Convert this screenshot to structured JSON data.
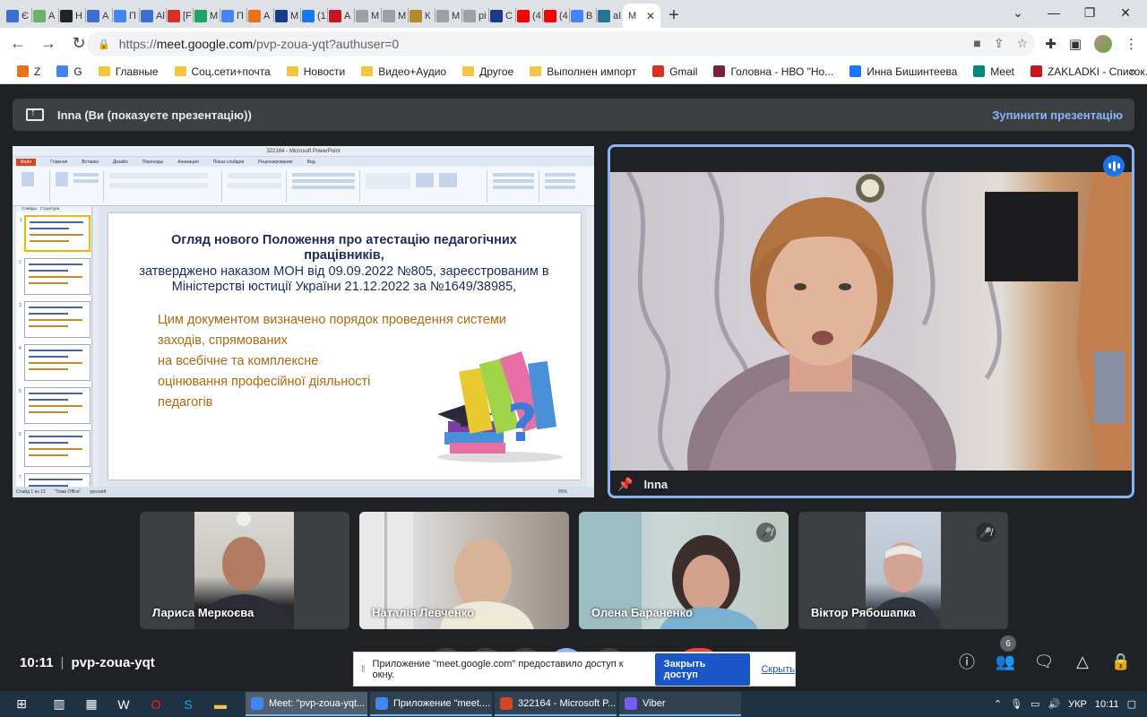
{
  "browser": {
    "tabs": [
      {
        "icon_color": "#3b6fd3",
        "label": "Є"
      },
      {
        "icon_color": "#6bb36b",
        "label": "А"
      },
      {
        "icon_color": "#222222",
        "label": "Н"
      },
      {
        "icon_color": "#3b6fd3",
        "label": "А"
      },
      {
        "icon_color": "#4285f4",
        "label": "П"
      },
      {
        "icon_color": "#3b6fd3",
        "label": "Аl"
      },
      {
        "icon_color": "#d93025",
        "label": "[F"
      },
      {
        "icon_color": "#1fa463",
        "label": "М"
      },
      {
        "icon_color": "#4285f4",
        "label": "П"
      },
      {
        "icon_color": "#e8711a",
        "label": "А"
      },
      {
        "icon_color": "#1a3a8a",
        "label": "М"
      },
      {
        "icon_color": "#1877f2",
        "label": "(1"
      },
      {
        "icon_color": "#c4161c",
        "label": "А"
      },
      {
        "icon_color": "#9aa0a6",
        "label": "М"
      },
      {
        "icon_color": "#9aa0a6",
        "label": "М"
      },
      {
        "icon_color": "#b48a2c",
        "label": "К"
      },
      {
        "icon_color": "#9aa0a6",
        "label": "М"
      },
      {
        "icon_color": "#9aa0a6",
        "label": "рі"
      },
      {
        "icon_color": "#1a3a8a",
        "label": "С"
      },
      {
        "icon_color": "#ff0000",
        "label": "(4"
      },
      {
        "icon_color": "#ff0000",
        "label": "(4"
      },
      {
        "icon_color": "#4285f4",
        "label": "В"
      },
      {
        "icon_color": "#21759b",
        "label": "аІ"
      }
    ],
    "active_tab": {
      "label": "М",
      "close": "✕"
    },
    "new_tab": "+",
    "url": {
      "scheme": "https://",
      "host": "meet.google.com",
      "path": "/pvp-zoua-yqt?authuser=0"
    },
    "bookmarks": [
      {
        "kind": "fav",
        "color": "#e8711a",
        "label": "Z"
      },
      {
        "kind": "fav",
        "color": "#4285f4",
        "label": "G"
      },
      {
        "kind": "folder",
        "label": "Главные"
      },
      {
        "kind": "folder",
        "label": "Соц.сети+почта"
      },
      {
        "kind": "folder",
        "label": "Новости"
      },
      {
        "kind": "folder",
        "label": "Видео+Аудио"
      },
      {
        "kind": "folder",
        "label": "Другое"
      },
      {
        "kind": "folder",
        "label": "Выполнен импорт"
      },
      {
        "kind": "fav",
        "color": "#d93025",
        "label": "Gmail"
      },
      {
        "kind": "fav",
        "color": "#7a1f3d",
        "label": "Головна - НВО \"Но..."
      },
      {
        "kind": "fav",
        "color": "#1877f2",
        "label": "Инна Бишинтеева"
      },
      {
        "kind": "fav",
        "color": "#00897b",
        "label": "Meet"
      },
      {
        "kind": "fav",
        "color": "#c4161c",
        "label": "ZAKLADKI - Список..."
      }
    ]
  },
  "meet": {
    "presenting_banner": "Inna (Ви (показуєте презентацію))",
    "stop_presenting": "Зупинити презентацію",
    "main_participant": "Inna",
    "participants": [
      {
        "name": "Лариса Меркоєва",
        "muted": false
      },
      {
        "name": "Наталія Левченко",
        "muted": false
      },
      {
        "name": "Олена Бараненко",
        "muted": true
      },
      {
        "name": "Віктор Рябошапка",
        "muted": true
      }
    ],
    "time": "10:11",
    "meeting_code": "pvp-zoua-yqt",
    "participant_count": "6",
    "share_notice": "Приложение \"meet.google.com\" предоставило доступ к окну.",
    "share_stop_button": "Закрыть доступ",
    "share_hide_link": "Скрыть"
  },
  "presentation": {
    "window_title": "322164 - Microsoft PowerPoint",
    "menu": [
      "Файл",
      "Главная",
      "Вставка",
      "Дизайн",
      "Переходы",
      "Анимация",
      "Показ слайдов",
      "Рецензирование",
      "Вид"
    ],
    "thumb_tabs": [
      "Слайды",
      "Структура"
    ],
    "thumb_numbers": [
      "1",
      "2",
      "3",
      "4",
      "5",
      "6",
      "7"
    ],
    "slide_title": "Огляд нового Положення про атестацію педагогічних працівників,",
    "slide_sub": "затверджено наказом МОН від 09.09.2022 №805, зареєстрованим в Міністерстві юстиції України 21.12.2022 за №1649/38985,",
    "slide_body": [
      "Цим документом визначено порядок проведення системи",
      "заходів, спрямованих",
      "на всебічне та комплексне",
      "оцінювання професійної діяльності",
      "педагогів"
    ],
    "status_left": "Слайд 1 из 12",
    "status_theme": "\"Тема Office\"",
    "status_lang": "русский",
    "status_zoom": "55%"
  },
  "taskbar": {
    "apps": [
      {
        "label": "Meet: \"pvp-zoua-yqt...",
        "color": "#4285f4",
        "active": true
      },
      {
        "label": "Приложение \"meet....",
        "color": "#4285f4",
        "active": false
      },
      {
        "label": "322164 - Microsoft P...",
        "color": "#d24726",
        "active": false
      },
      {
        "label": "Viber",
        "color": "#7360f2",
        "active": false
      }
    ],
    "lang": "УКР",
    "clock": "10:11"
  }
}
